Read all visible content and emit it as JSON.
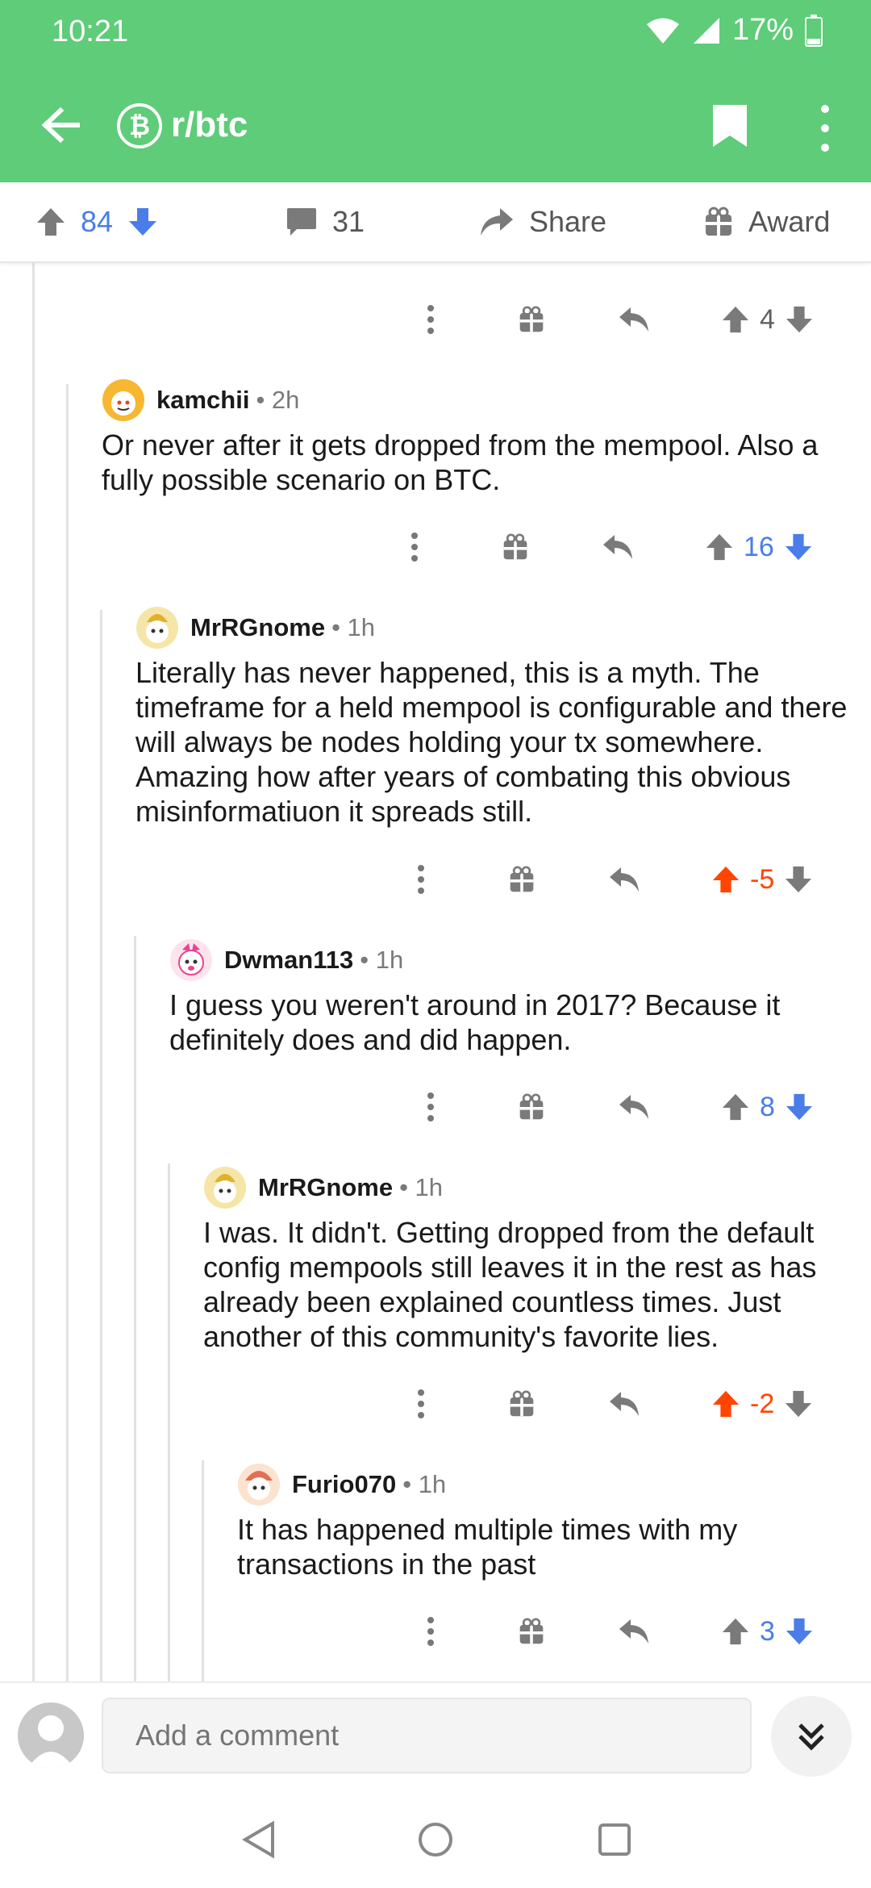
{
  "status": {
    "time": "10:21",
    "battery": "17%"
  },
  "header": {
    "subreddit": "r/btc",
    "sub_icon": "bitcoin-icon"
  },
  "post_actions": {
    "upvotes": "84",
    "comments": "31",
    "share": "Share",
    "award": "Award"
  },
  "top_comment_actions": {
    "score": "4"
  },
  "comments": [
    {
      "user": "kamchii",
      "time": "2h",
      "body": "Or never after it gets dropped from the mempool. Also a fully possible scenario on BTC.",
      "score": "16"
    },
    {
      "user": "MrRGnome",
      "time": "1h",
      "body": "Literally has never happened, this is a myth. The timeframe for a held mempool is configurable and there will always be nodes holding your tx somewhere. Amazing how after years of combating this obvious misinformatiuon it spreads still.",
      "score": "-5"
    },
    {
      "user": "Dwman113",
      "time": "1h",
      "body": "I guess you weren't around in 2017? Because it definitely does and did happen.",
      "score": "8"
    },
    {
      "user": "MrRGnome",
      "time": "1h",
      "body": "I was. It didn't. Getting dropped from the default config mempools still leaves it in the rest as has already been explained countless times. Just another of this community's favorite lies.",
      "score": "-2"
    },
    {
      "user": "Furio070",
      "time": "1h",
      "body": "It has happened multiple times with my transactions in the past",
      "score": "3"
    }
  ],
  "bottom": {
    "placeholder": "Add a comment"
  },
  "colors": {
    "brand": "#5ECC78",
    "upvote": "#ff4500",
    "downvote": "#4a7de8"
  }
}
